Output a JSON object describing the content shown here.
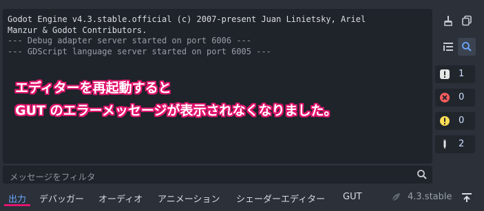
{
  "output": {
    "log_lines": [
      "Godot Engine v4.3.stable.official (c) 2007-present Juan Linietsky, Ariel",
      "Manzur & Godot Contributors.",
      "--- Debug adapter server started on port 6006 ---",
      "--- GDScript language server started on port 6005 ---"
    ],
    "annotation": {
      "line1": "エディターを再起動すると",
      "line2": "GUT のエラーメッセージが表示されなくなりました。"
    }
  },
  "filter": {
    "placeholder": "メッセージをフィルタ"
  },
  "counters": [
    {
      "icon": "info-icon",
      "value": "1",
      "color": "#e6e6e6"
    },
    {
      "icon": "error-icon",
      "value": "0",
      "color": "#ff5d5d"
    },
    {
      "icon": "warning-icon",
      "value": "0",
      "color": "#ffdd55"
    },
    {
      "icon": "editor-icon",
      "value": "2",
      "color": "#e6e6e6"
    }
  ],
  "tabs": {
    "items": [
      "出力",
      "デバッガー",
      "オーディオ",
      "アニメーション",
      "シェーダーエディター",
      "GUT"
    ],
    "active": "出力",
    "version": "4.3.stable"
  },
  "colors": {
    "accent": "#6aa7ff",
    "annotation_outline": "#e2156f"
  }
}
